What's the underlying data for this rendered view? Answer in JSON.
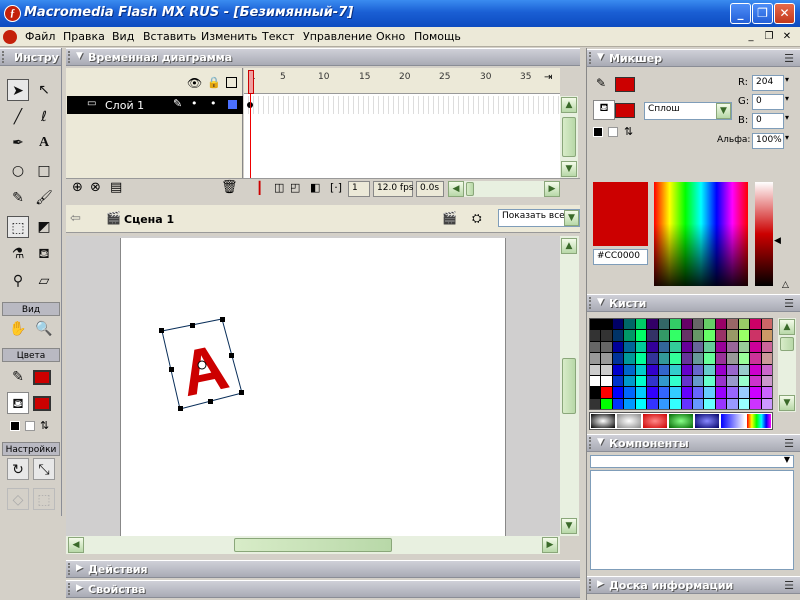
{
  "window": {
    "title": "Macromedia Flash MX RUS - [Безимянный-7]",
    "minimize": "_",
    "restore": "❐",
    "close": "✕",
    "title_color": "#1a5fd4"
  },
  "menubar": {
    "items": [
      "Файл",
      "Правка",
      "Вид",
      "Вставить",
      "Изменить",
      "Текст",
      "Управление",
      "Окно",
      "Помощь"
    ]
  },
  "toolbox": {
    "title": "Инстру",
    "view_label": "Вид",
    "colors_label": "Цвета",
    "options_label": "Настройки"
  },
  "timeline": {
    "title": "Временная диаграмма",
    "layer_name": "Слой 1",
    "ruler_ticks": [
      "1",
      "5",
      "10",
      "15",
      "20",
      "25",
      "30",
      "35"
    ],
    "current_frame": "1",
    "frame_rate": "12.0 fps",
    "elapsed": "0.0s"
  },
  "scene": {
    "name": "Сцена 1",
    "zoom": "Показать все"
  },
  "stage": {
    "letter": "A",
    "letter_color": "#cc0000"
  },
  "panels": {
    "bottom": [
      "Действия",
      "Свойства"
    ],
    "mixer": {
      "title": "Микшер",
      "fill_type": "Сплош",
      "r_label": "R:",
      "g_label": "G:",
      "b_label": "B:",
      "alpha_label": "Альфа:",
      "r": "204",
      "g": "0",
      "b": "0",
      "alpha": "100%",
      "hex": "#CC0000",
      "color": "#cc0000"
    },
    "swatches_title": "Кисти",
    "components_title": "Компоненты",
    "info_title": "Доска информации"
  }
}
